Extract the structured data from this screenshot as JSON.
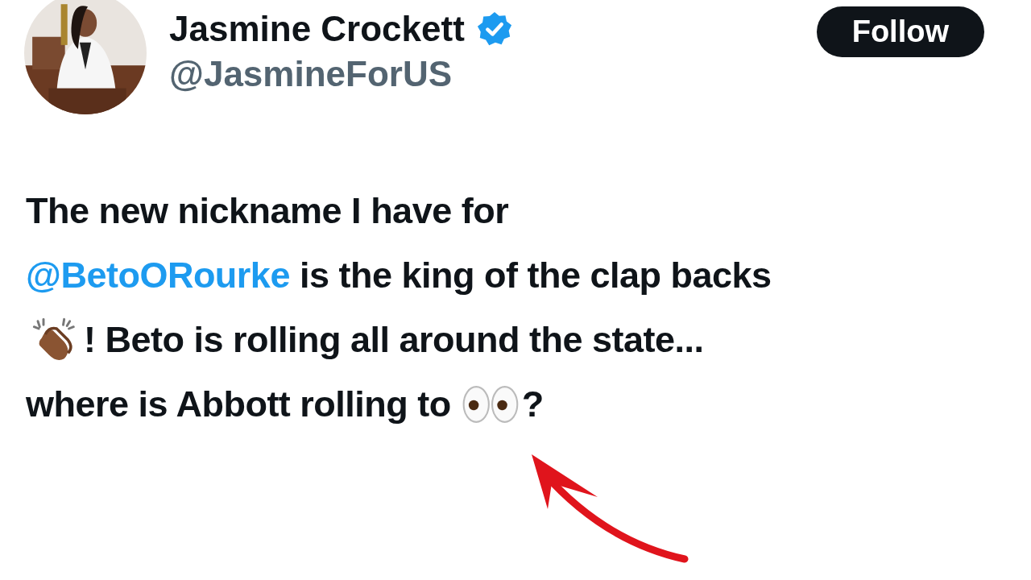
{
  "author": {
    "name": "Jasmine Crockett",
    "verified": true,
    "handle": "@JasmineForUS"
  },
  "follow_button": {
    "label": "Follow"
  },
  "post": {
    "lines": [
      [
        {
          "kind": "text",
          "text": "The new nickname I have for"
        }
      ],
      [
        {
          "kind": "mention",
          "text": "@BetoORourke"
        },
        {
          "kind": "text",
          "text": " is the king of the clap backs"
        }
      ],
      [
        {
          "kind": "clap"
        },
        {
          "kind": "text",
          "text": "! Beto is rolling all around the state..."
        }
      ],
      [
        {
          "kind": "text",
          "text": "where is Abbott rolling to "
        },
        {
          "kind": "eyes"
        },
        {
          "kind": "text",
          "text": "?"
        }
      ]
    ]
  },
  "annotation": {
    "kind": "arrow"
  }
}
